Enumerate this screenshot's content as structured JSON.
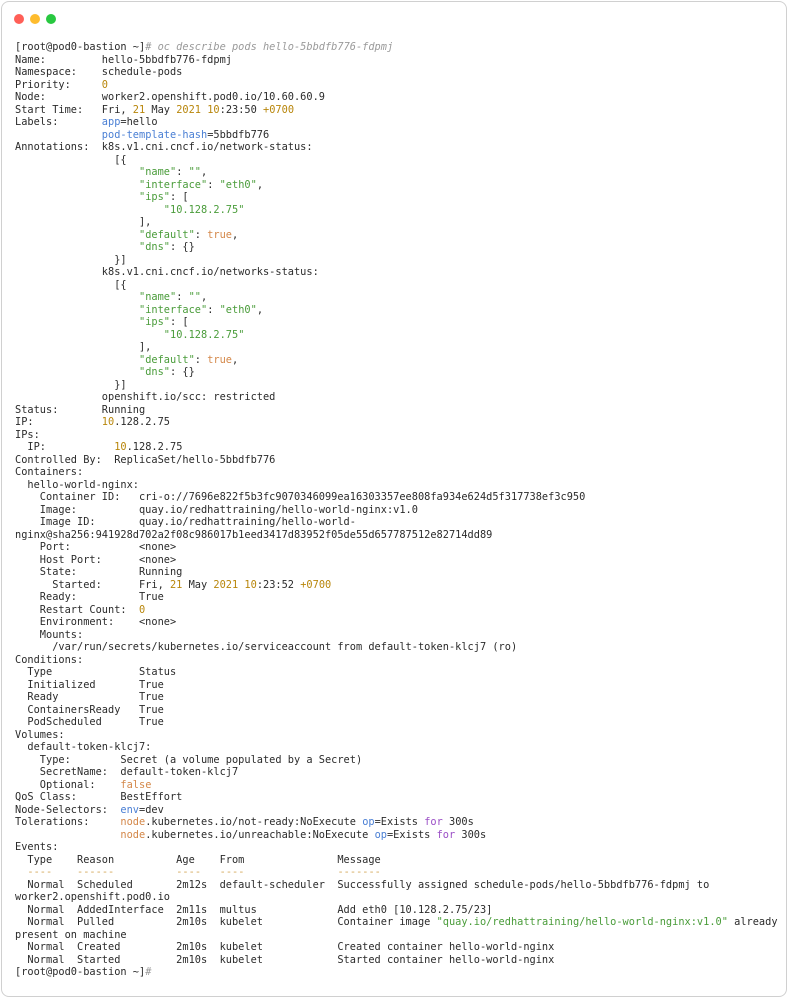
{
  "window": {
    "buttons": [
      "close",
      "minimize",
      "zoom"
    ]
  },
  "colors": {
    "string": "#4a9c3a",
    "number": "#b8860b",
    "keyword": "#d4884a",
    "key": "#4a7fd4",
    "comment": "#9a9a9a",
    "purple": "#9b4fc6"
  },
  "terminal": {
    "lines": [
      [
        [
          "",
          "[root@pod0-bastion ~]"
        ],
        [
          "cmt",
          "# oc describe pods hello-5bbdfb776-fdpmj"
        ]
      ],
      [
        [
          "",
          "Name:         hello-5bbdfb776-fdpmj"
        ]
      ],
      [
        [
          "",
          "Namespace:    schedule-pods"
        ]
      ],
      [
        [
          "",
          "Priority:     "
        ],
        [
          "num",
          "0"
        ]
      ],
      [
        [
          "",
          "Node:         worker2.openshift.pod0.io/10.60.60.9"
        ]
      ],
      [
        [
          "",
          "Start Time:   Fri, "
        ],
        [
          "num",
          "21"
        ],
        [
          "",
          " May "
        ],
        [
          "num",
          "2021"
        ],
        [
          "",
          " "
        ],
        [
          "num",
          "10"
        ],
        [
          "",
          ":23:50 "
        ],
        [
          "num",
          "+0700"
        ]
      ],
      [
        [
          "",
          "Labels:       "
        ],
        [
          "key",
          "app"
        ],
        [
          "",
          "=hello"
        ]
      ],
      [
        [
          "",
          "              "
        ],
        [
          "key",
          "pod-template-hash"
        ],
        [
          "",
          "=5bbdfb776"
        ]
      ],
      [
        [
          "",
          "Annotations:  k8s.v1.cni.cncf.io/network-status:"
        ]
      ],
      [
        [
          "",
          "                [{"
        ]
      ],
      [
        [
          "",
          "                    "
        ],
        [
          "str",
          "\"name\""
        ],
        [
          "",
          ": "
        ],
        [
          "str",
          "\"\""
        ],
        [
          "",
          ","
        ]
      ],
      [
        [
          "",
          "                    "
        ],
        [
          "str",
          "\"interface\""
        ],
        [
          "",
          ": "
        ],
        [
          "str",
          "\"eth0\""
        ],
        [
          "",
          ","
        ]
      ],
      [
        [
          "",
          "                    "
        ],
        [
          "str",
          "\"ips\""
        ],
        [
          "",
          ": ["
        ]
      ],
      [
        [
          "",
          "                        "
        ],
        [
          "str",
          "\"10.128.2.75\""
        ]
      ],
      [
        [
          "",
          "                    ],"
        ]
      ],
      [
        [
          "",
          "                    "
        ],
        [
          "str",
          "\"default\""
        ],
        [
          "",
          ": "
        ],
        [
          "kw",
          "true"
        ],
        [
          "",
          ","
        ]
      ],
      [
        [
          "",
          "                    "
        ],
        [
          "str",
          "\"dns\""
        ],
        [
          "",
          ": {}"
        ]
      ],
      [
        [
          "",
          "                }]"
        ]
      ],
      [
        [
          "",
          "              k8s.v1.cni.cncf.io/networks-status:"
        ]
      ],
      [
        [
          "",
          "                [{"
        ]
      ],
      [
        [
          "",
          "                    "
        ],
        [
          "str",
          "\"name\""
        ],
        [
          "",
          ": "
        ],
        [
          "str",
          "\"\""
        ],
        [
          "",
          ","
        ]
      ],
      [
        [
          "",
          "                    "
        ],
        [
          "str",
          "\"interface\""
        ],
        [
          "",
          ": "
        ],
        [
          "str",
          "\"eth0\""
        ],
        [
          "",
          ","
        ]
      ],
      [
        [
          "",
          "                    "
        ],
        [
          "str",
          "\"ips\""
        ],
        [
          "",
          ": ["
        ]
      ],
      [
        [
          "",
          "                        "
        ],
        [
          "str",
          "\"10.128.2.75\""
        ]
      ],
      [
        [
          "",
          "                    ],"
        ]
      ],
      [
        [
          "",
          "                    "
        ],
        [
          "str",
          "\"default\""
        ],
        [
          "",
          ": "
        ],
        [
          "kw",
          "true"
        ],
        [
          "",
          ","
        ]
      ],
      [
        [
          "",
          "                    "
        ],
        [
          "str",
          "\"dns\""
        ],
        [
          "",
          ": {}"
        ]
      ],
      [
        [
          "",
          "                }]"
        ]
      ],
      [
        [
          "",
          "              openshift.io/scc: restricted"
        ]
      ],
      [
        [
          "",
          "Status:       Running"
        ]
      ],
      [
        [
          "",
          "IP:           "
        ],
        [
          "num",
          "10"
        ],
        [
          "",
          ".128.2.75"
        ]
      ],
      [
        [
          "",
          "IPs:"
        ]
      ],
      [
        [
          "",
          "  IP:           "
        ],
        [
          "num",
          "10"
        ],
        [
          "",
          ".128.2.75"
        ]
      ],
      [
        [
          "",
          "Controlled By:  ReplicaSet/hello-5bbdfb776"
        ]
      ],
      [
        [
          "",
          "Containers:"
        ]
      ],
      [
        [
          "",
          "  hello-world-nginx:"
        ]
      ],
      [
        [
          "",
          "    Container ID:   cri-o://7696e822f5b3fc9070346099ea16303357ee808fa934e624d5f317738ef3c950"
        ]
      ],
      [
        [
          "",
          "    Image:          quay.io/redhattraining/hello-world-nginx:v1.0"
        ]
      ],
      [
        [
          "",
          "    Image ID:       quay.io/redhattraining/hello-world-"
        ]
      ],
      [
        [
          "",
          "nginx@sha256:941928d702a2f08c986017b1eed3417d83952f05de55d657787512e82714dd89"
        ]
      ],
      [
        [
          "",
          "    Port:           <none>"
        ]
      ],
      [
        [
          "",
          "    Host Port:      <none>"
        ]
      ],
      [
        [
          "",
          "    State:          Running"
        ]
      ],
      [
        [
          "",
          "      Started:      Fri, "
        ],
        [
          "num",
          "21"
        ],
        [
          "",
          " May "
        ],
        [
          "num",
          "2021"
        ],
        [
          "",
          " "
        ],
        [
          "num",
          "10"
        ],
        [
          "",
          ":23:52 "
        ],
        [
          "num",
          "+0700"
        ]
      ],
      [
        [
          "",
          "    Ready:          True"
        ]
      ],
      [
        [
          "",
          "    Restart Count:  "
        ],
        [
          "num",
          "0"
        ]
      ],
      [
        [
          "",
          "    Environment:    <none>"
        ]
      ],
      [
        [
          "",
          "    Mounts:"
        ]
      ],
      [
        [
          "",
          "      /var/run/secrets/kubernetes.io/serviceaccount from default-token-klcj7 (ro)"
        ]
      ],
      [
        [
          "",
          "Conditions:"
        ]
      ],
      [
        [
          "",
          "  Type              Status"
        ]
      ],
      [
        [
          "",
          "  Initialized       True"
        ]
      ],
      [
        [
          "",
          "  Ready             True"
        ]
      ],
      [
        [
          "",
          "  ContainersReady   True"
        ]
      ],
      [
        [
          "",
          "  PodScheduled      True"
        ]
      ],
      [
        [
          "",
          "Volumes:"
        ]
      ],
      [
        [
          "",
          "  default-token-klcj7:"
        ]
      ],
      [
        [
          "",
          "    Type:        Secret (a volume populated by a Secret)"
        ]
      ],
      [
        [
          "",
          "    SecretName:  default-token-klcj7"
        ]
      ],
      [
        [
          "",
          "    Optional:    "
        ],
        [
          "kw",
          "false"
        ]
      ],
      [
        [
          "",
          "QoS Class:       BestEffort"
        ]
      ],
      [
        [
          "",
          "Node-Selectors:  "
        ],
        [
          "key",
          "env"
        ],
        [
          "",
          "=dev"
        ]
      ],
      [
        [
          "",
          "Tolerations:     "
        ],
        [
          "kw",
          "node"
        ],
        [
          "",
          ".kubernetes.io/not-ready:NoExecute "
        ],
        [
          "key",
          "op"
        ],
        [
          "",
          "=Exists "
        ],
        [
          "pur",
          "for"
        ],
        [
          "",
          " 300s"
        ]
      ],
      [
        [
          "",
          "                 "
        ],
        [
          "kw",
          "node"
        ],
        [
          "",
          ".kubernetes.io/unreachable:NoExecute "
        ],
        [
          "key",
          "op"
        ],
        [
          "",
          "=Exists "
        ],
        [
          "pur",
          "for"
        ],
        [
          "",
          " 300s"
        ]
      ],
      [
        [
          "",
          "Events:"
        ]
      ],
      [
        [
          "",
          "  Type    Reason          Age    From               Message"
        ]
      ],
      [
        [
          "",
          "  "
        ],
        [
          "dash",
          "----"
        ],
        [
          "",
          "    "
        ],
        [
          "dash",
          "------"
        ],
        [
          "",
          "          "
        ],
        [
          "dash",
          "----"
        ],
        [
          "",
          "   "
        ],
        [
          "dash",
          "----"
        ],
        [
          "",
          "               "
        ],
        [
          "dash",
          "-------"
        ]
      ],
      [
        [
          "",
          "  Normal  Scheduled       2m12s  default-scheduler  Successfully assigned schedule-pods/hello-5bbdfb776-fdpmj to"
        ]
      ],
      [
        [
          "",
          "worker2.openshift.pod0.io"
        ]
      ],
      [
        [
          "",
          "  Normal  AddedInterface  2m11s  multus             Add eth0 [10.128.2.75/23]"
        ]
      ],
      [
        [
          "",
          "  Normal  Pulled          2m10s  kubelet            Container image "
        ],
        [
          "str",
          "\"quay.io/redhattraining/hello-world-nginx:v1.0\""
        ],
        [
          "",
          " already"
        ]
      ],
      [
        [
          "",
          "present on machine"
        ]
      ],
      [
        [
          "",
          "  Normal  Created         2m10s  kubelet            Created container hello-world-nginx"
        ]
      ],
      [
        [
          "",
          "  Normal  Started         2m10s  kubelet            Started container hello-world-nginx"
        ]
      ],
      [
        [
          "",
          "[root@pod0-bastion ~]"
        ],
        [
          "cmt",
          "#"
        ]
      ]
    ]
  }
}
